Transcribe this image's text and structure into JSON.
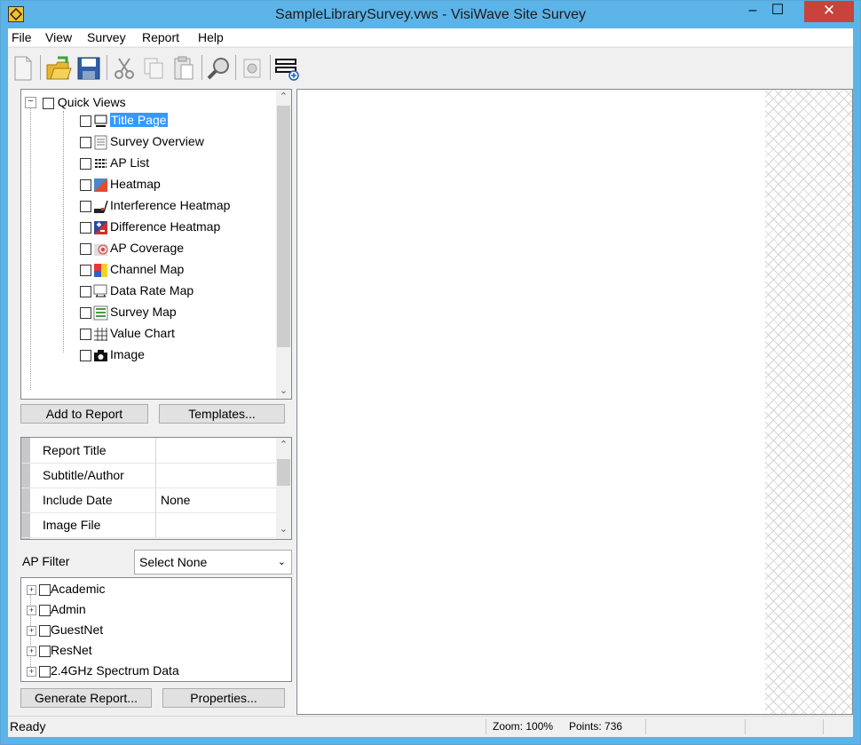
{
  "window": {
    "title": "SampleLibrarySurvey.vws - VisiWave Site Survey",
    "minimize": "–",
    "maximize": "☐",
    "close": "✕"
  },
  "menubar": {
    "items": [
      "File",
      "View",
      "Survey",
      "Report",
      "Help"
    ]
  },
  "toolbar": {
    "buttons": [
      "new-icon",
      "open-icon",
      "save-icon",
      "cut-icon",
      "copy-icon",
      "paste-icon",
      "zoom-icon",
      "print-icon",
      "add-layer-icon"
    ]
  },
  "quick_views": {
    "root": "Quick Views",
    "items": [
      {
        "label": "Title Page",
        "selected": true
      },
      {
        "label": "Survey Overview"
      },
      {
        "label": "AP List"
      },
      {
        "label": "Heatmap"
      },
      {
        "label": "Interference Heatmap"
      },
      {
        "label": "Difference Heatmap"
      },
      {
        "label": "AP Coverage"
      },
      {
        "label": "Channel Map"
      },
      {
        "label": "Data Rate Map"
      },
      {
        "label": "Survey Map"
      },
      {
        "label": "Value Chart"
      },
      {
        "label": "Image"
      }
    ],
    "add_button": "Add to Report",
    "templates_button": "Templates..."
  },
  "properties": {
    "rows": [
      {
        "label": "Report Title",
        "value": ""
      },
      {
        "label": "Subtitle/Author",
        "value": ""
      },
      {
        "label": "Include Date",
        "value": "None"
      },
      {
        "label": "Image File",
        "value": ""
      }
    ]
  },
  "ap_filter": {
    "label": "AP Filter",
    "select_value": "Select None",
    "items": [
      "Academic",
      "Admin",
      "GuestNet",
      "ResNet",
      "2.4GHz Spectrum Data"
    ],
    "generate_button": "Generate Report...",
    "properties_button": "Properties..."
  },
  "status": {
    "text": "Ready",
    "zoom": "Zoom: 100%",
    "points": "Points: 736"
  },
  "colors": {
    "titlebar": "#5cb3e8",
    "close": "#c7433b",
    "selection": "#3399ff"
  }
}
